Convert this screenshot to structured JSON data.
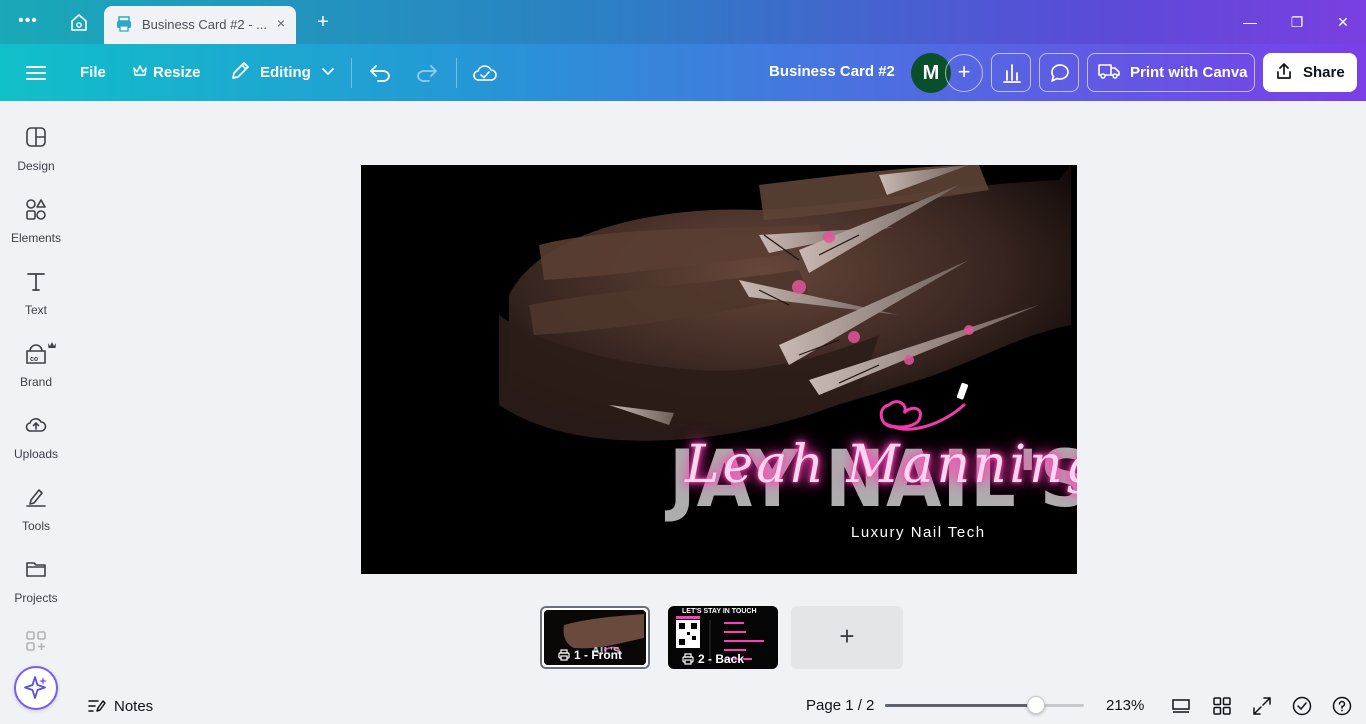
{
  "browser": {
    "tab_title": "Business Card #2 - ...",
    "close_glyph": "×",
    "new_tab_glyph": "+",
    "menu_glyph": "•••",
    "window_controls": {
      "minimize": "—",
      "restore": "❐",
      "close": "✕"
    }
  },
  "toolbar": {
    "file_label": "File",
    "resize_label": "Resize",
    "editing_label": "Editing",
    "doc_title": "Business Card #2",
    "avatar_initial": "M",
    "add_collaborator_glyph": "+",
    "print_label": "Print with Canva",
    "share_label": "Share"
  },
  "sidebar": {
    "items": [
      {
        "label": "Design",
        "icon": "design-icon"
      },
      {
        "label": "Elements",
        "icon": "elements-icon"
      },
      {
        "label": "Text",
        "icon": "text-icon"
      },
      {
        "label": "Brand",
        "icon": "brand-icon"
      },
      {
        "label": "Uploads",
        "icon": "uploads-icon"
      },
      {
        "label": "Tools",
        "icon": "tools-icon"
      },
      {
        "label": "Projects",
        "icon": "projects-icon"
      }
    ]
  },
  "canvas": {
    "brand_text": "JAY NAIL'S",
    "script_name": "Leah Manning",
    "tagline": "Luxury Nail Tech",
    "accent_color": "#ff3db5"
  },
  "pages": {
    "thumbs": [
      {
        "label": "1 - Front"
      },
      {
        "label": "2 - Back",
        "header": "LET'S STAY IN TOUCH"
      }
    ],
    "add_glyph": "+"
  },
  "footer": {
    "notes_label": "Notes",
    "page_indicator": "Page 1 / 2",
    "zoom_value": "213%",
    "zoom_fraction": 0.76
  }
}
